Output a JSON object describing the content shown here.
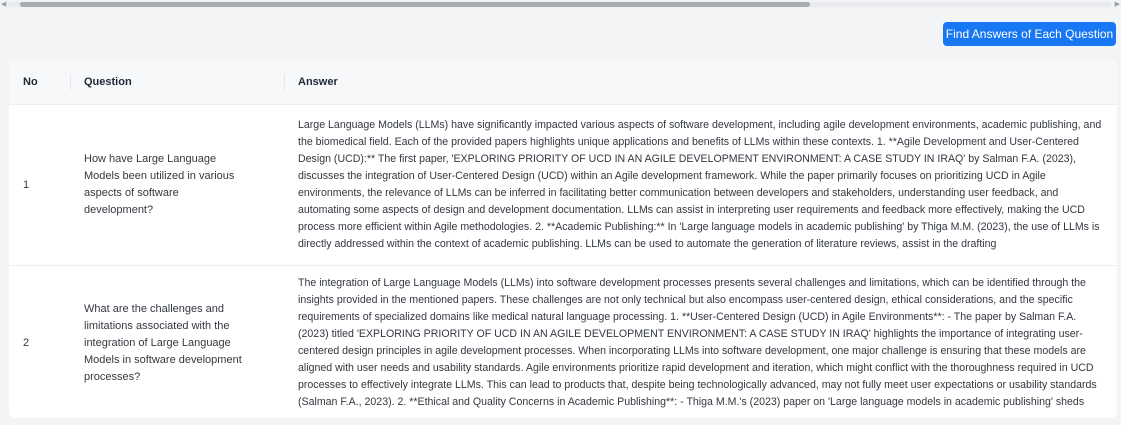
{
  "toolbar": {
    "find_answers_label": "Find Answers of Each Question"
  },
  "table": {
    "headers": {
      "no": "No",
      "question": "Question",
      "answer": "Answer"
    },
    "rows": [
      {
        "no": "1",
        "question": "How have Large Language Models been utilized in various aspects of software development?",
        "answer": "Large Language Models (LLMs) have significantly impacted various aspects of software development, including agile development environments, academic publishing, and the biomedical field. Each of the provided papers highlights unique applications and benefits of LLMs within these contexts. 1. **Agile Development and User-Centered Design (UCD):** The first paper, 'EXPLORING PRIORITY OF UCD IN AN AGILE DEVELOPMENT ENVIRONMENT: A CASE STUDY IN IRAQ' by Salman F.A. (2023), discusses the integration of User-Centered Design (UCD) within an Agile development framework. While the paper primarily focuses on prioritizing UCD in Agile environments, the relevance of LLMs can be inferred in facilitating better communication between developers and stakeholders, understanding user feedback, and automating some aspects of design and development documentation. LLMs can assist in interpreting user requirements and feedback more effectively, making the UCD process more efficient within Agile methodologies. 2. **Academic Publishing:** In 'Large language models in academic publishing' by Thiga M.M. (2023), the use of LLMs is directly addressed within the context of academic publishing. LLMs can be used to automate the generation of literature reviews, assist in the drafting"
      },
      {
        "no": "2",
        "question": "What are the challenges and limitations associated with the integration of Large Language Models in software development processes?",
        "answer": "The integration of Large Language Models (LLMs) into software development processes presents several challenges and limitations, which can be identified through the insights provided in the mentioned papers. These challenges are not only technical but also encompass user-centered design, ethical considerations, and the specific requirements of specialized domains like medical natural language processing. 1. **User-Centered Design (UCD) in Agile Environments**: - The paper by Salman F.A. (2023) titled 'EXPLORING PRIORITY OF UCD IN AN AGILE DEVELOPMENT ENVIRONMENT: A CASE STUDY IN IRAQ' highlights the importance of integrating user-centered design principles in agile development processes. When incorporating LLMs into software development, one major challenge is ensuring that these models are aligned with user needs and usability standards. Agile environments prioritize rapid development and iteration, which might conflict with the thoroughness required in UCD processes to effectively integrate LLMs. This can lead to products that, despite being technologically advanced, may not fully meet user expectations or usability standards (Salman F.A., 2023). 2. **Ethical and Quality Concerns in Academic Publishing**: - Thiga M.M.'s (2023) paper on 'Large language models in academic publishing' sheds"
      }
    ]
  }
}
